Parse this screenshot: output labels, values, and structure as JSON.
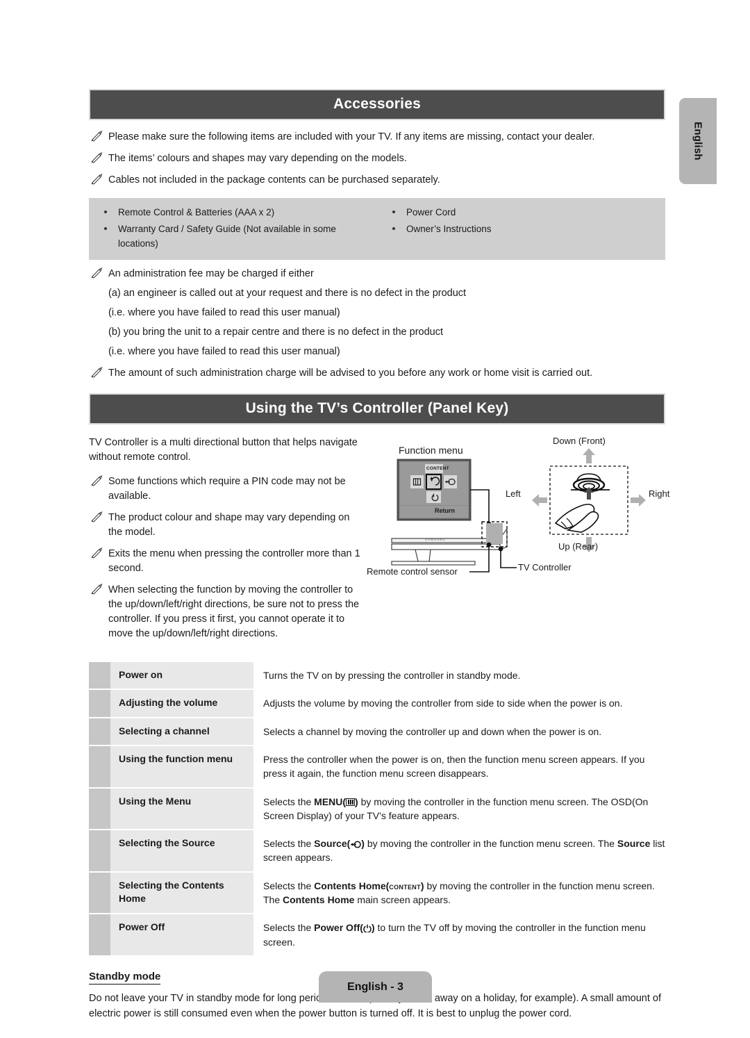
{
  "page": {
    "language_tab": "English",
    "footer": "English - 3"
  },
  "accessories": {
    "heading": "Accessories",
    "notes": [
      "Please make sure the following items are included with your TV. If any items are missing, contact your dealer.",
      "The items’ colours and shapes may vary depending on the models.",
      "Cables not included in the package contents can be purchased separately."
    ],
    "items_left": [
      "Remote Control & Batteries (AAA x 2)",
      "Warranty Card / Safety Guide (Not available in some locations)"
    ],
    "items_right": [
      "Power Cord",
      "Owner’s Instructions"
    ],
    "fee_note": "An administration fee may be charged if either",
    "fee_lines": [
      "(a) an engineer is called out at your request and there is no defect in the product",
      "(i.e. where you have failed to read this user manual)",
      "(b) you bring the unit to a repair centre and there is no defect in the product",
      "(i.e. where you have failed to read this user manual)"
    ],
    "charge_note": "The amount of such administration charge will be advised to you before any work or home visit is carried out."
  },
  "controller": {
    "heading": "Using the TV’s Controller (Panel Key)",
    "intro": "TV Controller is a multi directional button that helps navigate without remote control.",
    "notes": [
      "Some functions which require a PIN code may not be available.",
      "The product colour and shape may vary depending on the model.",
      "Exits the menu when pressing the controller more than 1 second.",
      "When selecting the function by moving the controller to the up/down/left/right directions, be sure not to press the controller. If you press it first, you cannot operate it to move the up/down/left/right directions."
    ],
    "diagram": {
      "function_menu_label": "Function menu",
      "menu_content_key": "CONTENT",
      "menu_return_label": "Return",
      "remote_sensor_label": "Remote control sensor",
      "tv_controller_label": "TV Controller",
      "brand": "SAMSUNG",
      "direction_down": "Down (Front)",
      "direction_up": "Up (Rear)",
      "direction_left": "Left",
      "direction_right": "Right"
    },
    "table": [
      {
        "label": "Power on",
        "desc_parts": [
          {
            "t": "Turns the TV on by pressing the controller in standby mode."
          }
        ]
      },
      {
        "label": "Adjusting the volume",
        "desc_parts": [
          {
            "t": "Adjusts the volume by moving the controller from side to side when the power is on."
          }
        ]
      },
      {
        "label": "Selecting a channel",
        "desc_parts": [
          {
            "t": "Selects a channel by moving the controller up and down when the power is on."
          }
        ]
      },
      {
        "label": "Using the function menu",
        "desc_parts": [
          {
            "t": "Press the controller when the power is on, then the function menu screen appears. If you press it again, the function menu screen disappears."
          }
        ]
      },
      {
        "label": "Using the Menu",
        "desc_parts": [
          {
            "t": "Selects the "
          },
          {
            "t": "MENU(",
            "b": true
          },
          {
            "icon": "menu-icon"
          },
          {
            "t": ")",
            "b": true
          },
          {
            "t": " by moving the controller in the function menu screen. The OSD(On Screen Display) of your TV’s feature appears."
          }
        ]
      },
      {
        "label": "Selecting the Source",
        "desc_parts": [
          {
            "t": "Selects the "
          },
          {
            "t": "Source(",
            "b": true
          },
          {
            "icon": "source-icon"
          },
          {
            "t": ")",
            "b": true
          },
          {
            "t": " by moving the controller in the function menu screen. The "
          },
          {
            "t": "Source",
            "b": true
          },
          {
            "t": " list screen appears."
          }
        ]
      },
      {
        "label": "Selecting the Contents Home",
        "desc_parts": [
          {
            "t": "Selects the "
          },
          {
            "t": "Contents Home(",
            "b": true
          },
          {
            "icon": "content-icon"
          },
          {
            "t": ")",
            "b": true
          },
          {
            "t": " by moving the controller in the function menu screen. The "
          },
          {
            "t": "Contents Home",
            "b": true
          },
          {
            "t": " main screen appears."
          }
        ]
      },
      {
        "label": "Power Off",
        "desc_parts": [
          {
            "t": "Selects the "
          },
          {
            "t": "Power Off(",
            "b": true
          },
          {
            "icon": "power-icon"
          },
          {
            "t": ")",
            "b": true
          },
          {
            "t": " to turn the TV off by moving the controller in the function menu screen."
          }
        ]
      }
    ]
  },
  "standby": {
    "title": "Standby mode",
    "body": "Do not leave your TV in standby mode for long periods of time (when you are away on a holiday, for example). A small amount of electric power is still consumed even when the power button is turned off. It is best to unplug the power cord."
  },
  "icons": {
    "menu": "menu-icon",
    "source": "source-icon",
    "content": "content-icon",
    "power": "power-icon",
    "return": "return-icon",
    "pencil": "pencil-note-icon"
  }
}
